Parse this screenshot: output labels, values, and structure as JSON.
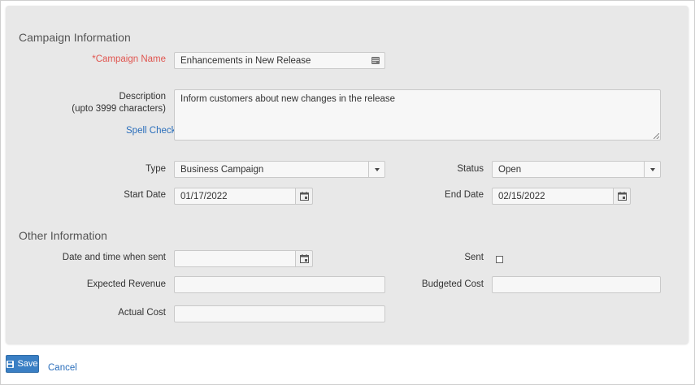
{
  "sections": {
    "campaign_info": "Campaign Information",
    "other_info": "Other Information"
  },
  "fields": {
    "campaign_name": {
      "label": "*Campaign Name",
      "value": "Enhancements in New Release"
    },
    "description": {
      "label_line1": "Description",
      "label_line2": "(upto 3999 characters)",
      "value": "Inform customers about new changes in the release",
      "spell_check": "Spell Check"
    },
    "type": {
      "label": "Type",
      "value": "Business Campaign"
    },
    "status": {
      "label": "Status",
      "value": "Open"
    },
    "start_date": {
      "label": "Start Date",
      "value": "01/17/2022"
    },
    "end_date": {
      "label": "End Date",
      "value": "02/15/2022"
    },
    "date_time_sent": {
      "label": "Date and time when sent",
      "value": ""
    },
    "sent": {
      "label": "Sent",
      "checked": false
    },
    "expected_revenue": {
      "label": "Expected Revenue",
      "value": ""
    },
    "budgeted_cost": {
      "label": "Budgeted Cost",
      "value": ""
    },
    "actual_cost": {
      "label": "Actual Cost",
      "value": ""
    }
  },
  "actions": {
    "save": "Save",
    "cancel": "Cancel"
  },
  "colors": {
    "required": "#e0554f",
    "link": "#2a6ebb",
    "primary": "#3a7fc4",
    "panel": "#e8e8e8"
  }
}
